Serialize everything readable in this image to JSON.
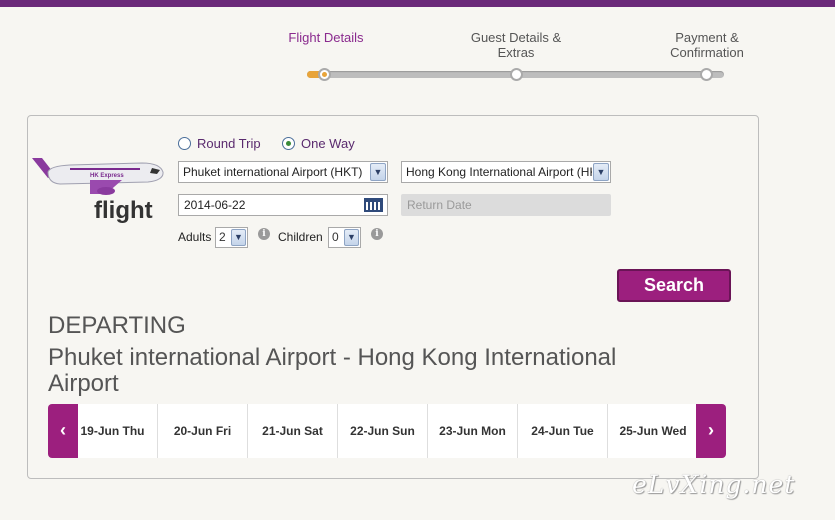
{
  "steps": [
    "Flight Details",
    "Guest Details & Extras",
    "Payment & Confirmation"
  ],
  "progress_fraction": 0.04,
  "colors": {
    "brand_purple": "#9c1f7e",
    "top_bar": "#6b2a7a",
    "progress_accent": "#e8a43a"
  },
  "logo": {
    "airline_mark": "HK Express",
    "caption": "flight"
  },
  "trip_type": {
    "round_trip": "Round Trip",
    "one_way": "One Way",
    "selected": "One Way"
  },
  "from_airport": "Phuket international Airport (HKT)",
  "to_airport": "Hong Kong International Airport (HKG)",
  "depart_date": "2014-06-22",
  "return_placeholder": "Return Date",
  "adults": {
    "label": "Adults",
    "value": "2"
  },
  "children": {
    "label": "Children",
    "value": "0"
  },
  "search_label": "Search",
  "results": {
    "heading": "DEPARTING",
    "route": "Phuket international Airport - Hong Kong International Airport"
  },
  "dates": [
    "19-Jun Thu",
    "20-Jun Fri",
    "21-Jun Sat",
    "22-Jun Sun",
    "23-Jun Mon",
    "24-Jun Tue",
    "25-Jun Wed"
  ],
  "nav": {
    "prev": "‹",
    "next": "›"
  },
  "watermark": "eLvXing.net"
}
